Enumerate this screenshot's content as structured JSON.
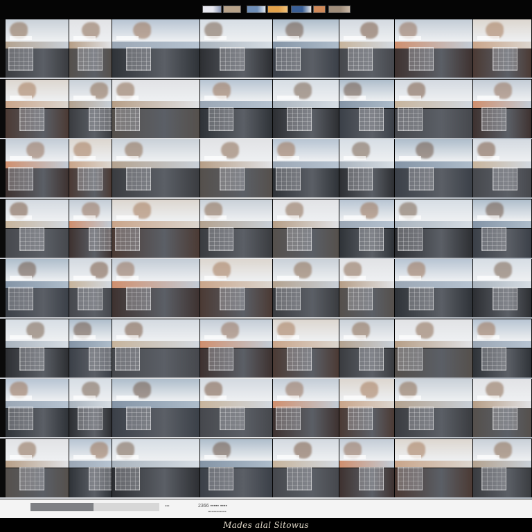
{
  "toolbar": {
    "chips": [
      {
        "color": "#e8e8f0",
        "accent": "#8a96b4"
      },
      {
        "color": "#b8a38a",
        "accent": "#b8a38a"
      },
      {
        "color": "#6f8fb8",
        "accent": "#dfe6ee"
      },
      {
        "color": "#e3a24a",
        "accent": "#f1c27a"
      },
      {
        "color": "#3a5f96",
        "accent": "#e6e6e6"
      },
      {
        "color": "#d08a5a",
        "accent": "#d08a5a"
      },
      {
        "color": "#a08d7a",
        "accent": "#c9b8a6"
      }
    ]
  },
  "grid": {
    "rows": 8,
    "columns": 8,
    "palettes": [
      {
        "sky": "#c9d0d8",
        "band": "#b3a28f",
        "ground": "#3a3c40",
        "tree": "#8a6a50"
      },
      {
        "sky": "#d3d9e0",
        "band": "#c7b49c",
        "ground": "#46484d",
        "tree": "#7b5a44"
      },
      {
        "sky": "#b7c4d2",
        "band": "#9aa6b4",
        "ground": "#2f3338",
        "tree": "#9a7256"
      },
      {
        "sky": "#dcd6cf",
        "band": "#c9a58a",
        "ground": "#4b3a34",
        "tree": "#a57a5a"
      },
      {
        "sky": "#aebdcb",
        "band": "#8494a6",
        "ground": "#3b4048",
        "tree": "#6d5546"
      },
      {
        "sky": "#e1e2e5",
        "band": "#b69e86",
        "ground": "#55504c",
        "tree": "#8c6b52"
      },
      {
        "sky": "#c3ccd6",
        "band": "#cf8f6e",
        "ground": "#3e3230",
        "tree": "#94705a"
      },
      {
        "sky": "#d6dde4",
        "band": "#a9b3bd",
        "ground": "#2d2f33",
        "tree": "#7a624f"
      }
    ]
  },
  "status": {
    "progress": 0.49,
    "dot": "▪▪▪",
    "counter": "2366 ▪▪▪▪▪ ▪▪▪▪",
    "sub": "▪▪▪▪▪▪▪▪▪▪▪▪▪▪▪"
  },
  "footer": {
    "label": "Mades alal Sitowus"
  }
}
